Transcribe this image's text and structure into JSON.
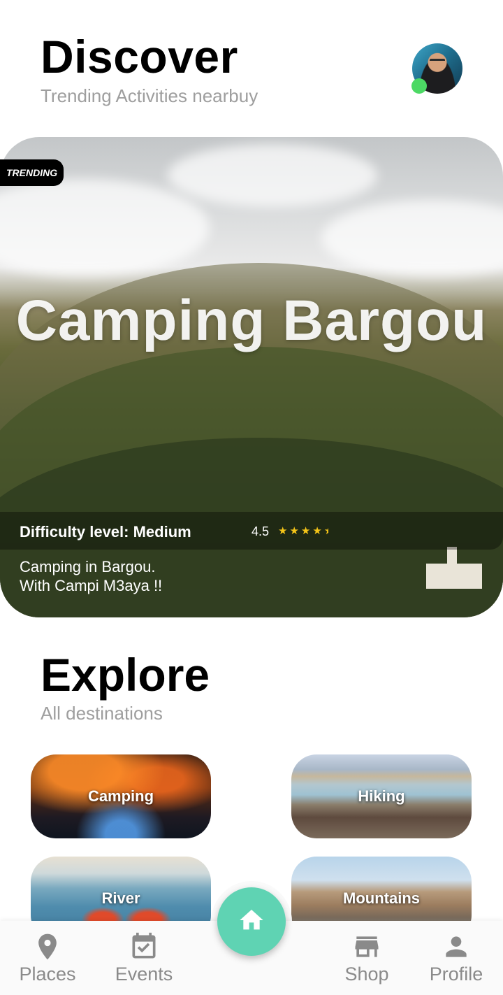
{
  "header": {
    "title": "Discover",
    "subtitle": "Trending Activities nearbuy"
  },
  "colors": {
    "accent": "#5fd3b3",
    "online": "#4cd964",
    "star": "#f5c518",
    "nav_inactive": "#8a8a8a"
  },
  "featured": {
    "badge": "TRENDING",
    "name": "Camping Bargou",
    "difficulty": "Difficulty level: Medium",
    "rating": "4.5",
    "rating_value": 4.5,
    "rating_max": 5,
    "description_line1": "Camping in Bargou.",
    "description_line2": "With Campi M3aya !!"
  },
  "explore": {
    "title": "Explore",
    "subtitle": "All destinations",
    "categories": [
      {
        "label": "Camping"
      },
      {
        "label": "Hiking"
      },
      {
        "label": "River"
      },
      {
        "label": "Mountains"
      }
    ]
  },
  "bottom_nav": {
    "items": [
      {
        "label": "Places",
        "icon": "map-pin-icon"
      },
      {
        "label": "Events",
        "icon": "calendar-check-icon"
      },
      {
        "label": "Shop",
        "icon": "store-icon"
      },
      {
        "label": "Profile",
        "icon": "person-icon"
      }
    ],
    "center_icon": "home-icon"
  }
}
